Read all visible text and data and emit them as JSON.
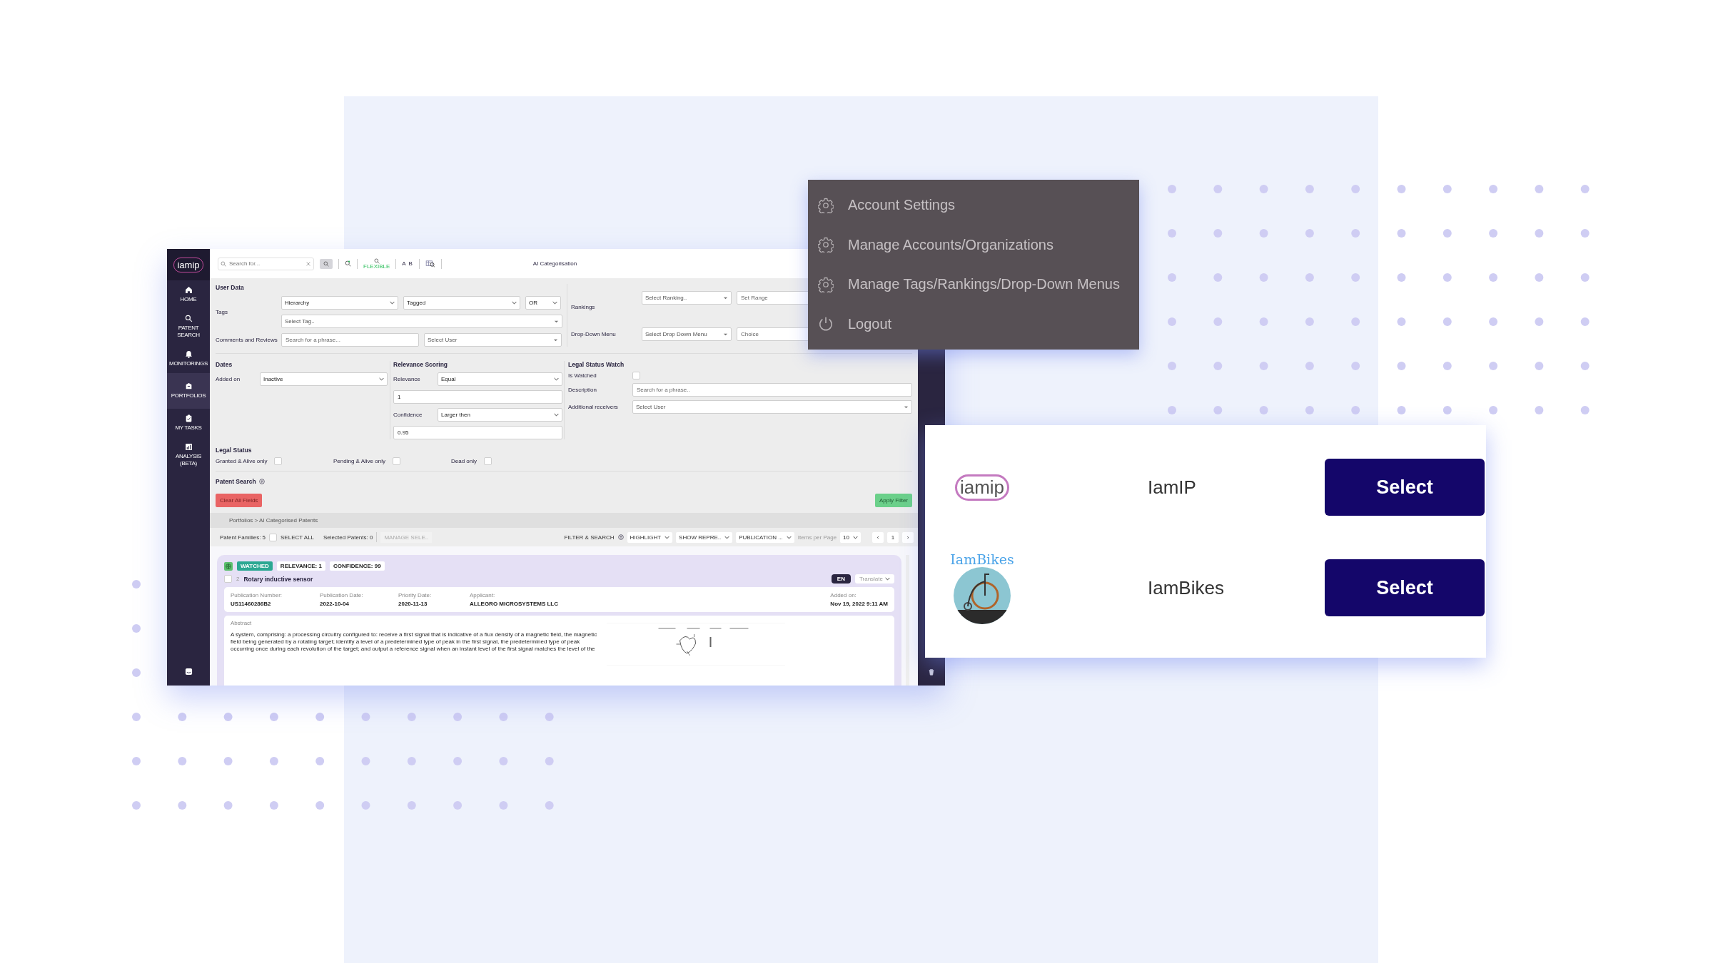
{
  "app": {
    "logo": "iamip",
    "sidebar": {
      "items": [
        {
          "label": "HOME",
          "selected": false
        },
        {
          "label": "PATENT SEARCH",
          "selected": false
        },
        {
          "label": "MONITORINGS",
          "selected": false
        },
        {
          "label": "PORTFOLIOS",
          "selected": true
        },
        {
          "label": "MY TASKS",
          "selected": false
        },
        {
          "label": "ANALYSIS (BETA)",
          "selected": false
        }
      ]
    },
    "toolbar": {
      "search": {
        "placeholder": "Search for..."
      },
      "flexible_label": "FLEXIBLE",
      "ab_label": "A B",
      "title": "AI Categorisation"
    },
    "user_data": {
      "title": "User Data",
      "tags_label": "Tags",
      "tag_selects": [
        "Hierarchy",
        "Tagged",
        "OR"
      ],
      "tag_picker": {
        "placeholder": "Select Tag.."
      },
      "comments_label": "Comments and Reviews",
      "comments_field": {
        "placeholder": "Search for a phrase..."
      },
      "user_picker": {
        "placeholder": "Select User"
      }
    },
    "rankings": {
      "label": "Rankings",
      "picker": {
        "placeholder": "Select Ranking.."
      },
      "range": {
        "placeholder": "Set Range"
      },
      "dropdown_label": "Drop-Down Menu",
      "dropdown_picker": {
        "placeholder": "Select Drop Down Menu"
      },
      "choice": {
        "placeholder": "Choice"
      }
    },
    "dates": {
      "title": "Dates",
      "label": "Added on",
      "value": "Inactive"
    },
    "relevance": {
      "title": "Relevance Scoring",
      "relevance_label": "Relevance",
      "relevance_value": "Equal",
      "relevance_input": "1",
      "confidence_label": "Confidence",
      "confidence_value": "Larger then",
      "confidence_input": "0.95"
    },
    "legal_watch": {
      "title": "Legal Status Watch",
      "watched_label": "Is Watched",
      "watched": false,
      "description_label": "Description",
      "description": {
        "placeholder": "Search for a phrase.."
      },
      "receivers_label": "Additional receivers",
      "receivers": {
        "placeholder": "Select User"
      }
    },
    "legal_status": {
      "title": "Legal Status",
      "options": [
        {
          "label": "Granted & Alive only",
          "checked": false
        },
        {
          "label": "Pending & Alive only",
          "checked": false
        },
        {
          "label": "Dead only",
          "checked": false
        }
      ]
    },
    "patent_search": "Patent Search",
    "clear_button": "Clear All Fields",
    "apply_button": "Apply Filter",
    "breadcrumb": "Portfolios > AI Categorised Patents",
    "results_bar": {
      "families": "Patent Families: 5",
      "select_all_checked": false,
      "select_all": "SELECT ALL",
      "selected": "Selected Patents: 0",
      "manage": {
        "label": "MANAGE SELE..",
        "disabled": true
      },
      "filter_search": "FILTER & SEARCH",
      "dropdowns": [
        "HIGHLIGHT",
        "SHOW REPRE..",
        "PUBLICATION ..."
      ],
      "items_per_page_label": "Items per Page",
      "items_per_page": "10",
      "pages": [
        "‹",
        "1",
        "›"
      ]
    },
    "card": {
      "badges": [
        {
          "label": "WATCHED",
          "kind": "status"
        },
        {
          "label": "RELEVANCE: 1",
          "kind": "plain"
        },
        {
          "label": "CONFIDENCE: 99",
          "kind": "plain"
        }
      ],
      "checked": false,
      "index": "2",
      "title": "Rotary inductive sensor",
      "language": "EN",
      "translate": "Translate",
      "fields": [
        {
          "label": "Publication Number:",
          "value": "US11460286B2"
        },
        {
          "label": "Publication Date:",
          "value": "2022-10-04"
        },
        {
          "label": "Priority Date:",
          "value": "2020-11-13"
        },
        {
          "label": "Applicant:",
          "value": "ALLEGRO MICROSYSTEMS LLC"
        }
      ],
      "added_label": "Added on:",
      "added_value": "Nov 19, 2022 9:11 AM",
      "abstract_label": "Abstract",
      "abstract_lines": [
        "A system, comprising: a processing circuitry configured to: receive a first signal that is indicative of a flux density of a magnetic field, the magnetic",
        "field being generated by a rotating target; identify a level of a predetermined type of peak in the first signal, the predetermined type of peak",
        "occurring once during each revolution of the target; and output a reference signal when an instant level of the first signal matches the level of the"
      ]
    }
  },
  "user_menu": {
    "items": [
      {
        "label": "Account Settings",
        "kind": "gear"
      },
      {
        "label": "Manage Accounts/Organizations",
        "kind": "gear"
      },
      {
        "label": "Manage Tags/Rankings/Drop-Down Menus",
        "kind": "gear"
      },
      {
        "label": "Logout",
        "kind": "power"
      }
    ]
  },
  "organizations": [
    {
      "kind": "ring_logo",
      "logo": "iamip",
      "name": "IamIP",
      "button": "Select"
    },
    {
      "kind": "picture_logo",
      "logo": "IamBikes",
      "name": "IamBikes",
      "button": "Select"
    }
  ]
}
